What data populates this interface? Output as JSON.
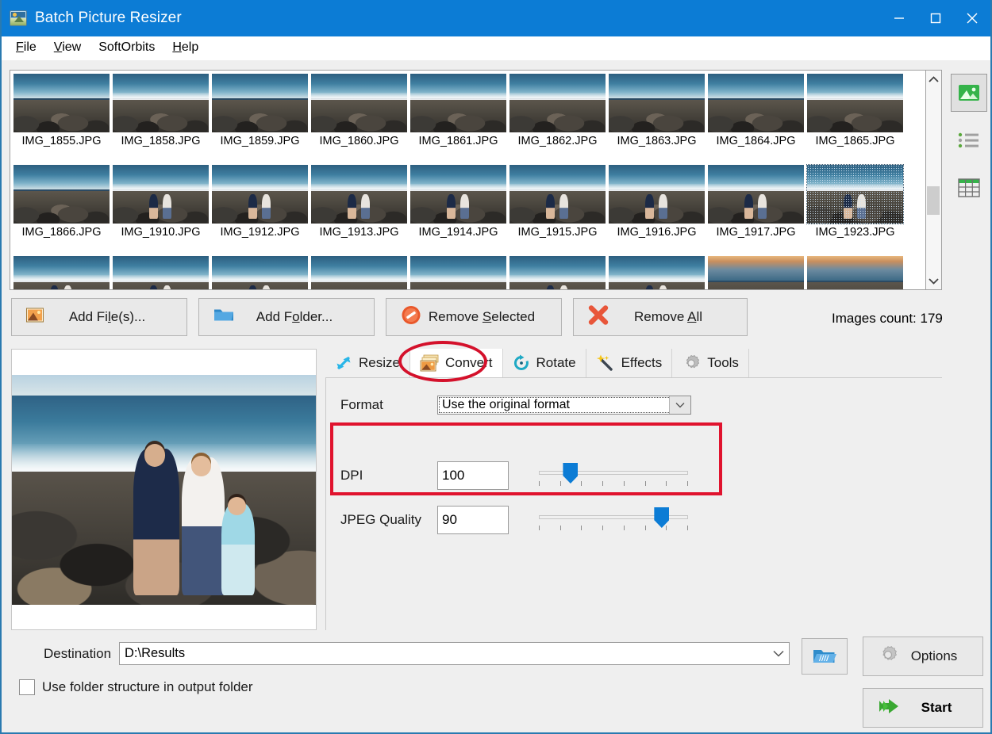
{
  "window": {
    "title": "Batch Picture Resizer",
    "accent_color": "#0c7cd5",
    "border_color": "#2a7ab0",
    "minimize_label": "Minimize",
    "maximize_label": "Maximize",
    "close_label": "Close"
  },
  "menu": {
    "items": [
      {
        "label": "File",
        "accel": "F"
      },
      {
        "label": "View",
        "accel": "V"
      },
      {
        "label": "SoftOrbits",
        "accel": ""
      },
      {
        "label": "Help",
        "accel": "H"
      }
    ]
  },
  "thumbnails": {
    "items": [
      {
        "name": "IMG_1855.JPG",
        "kind": "rocks",
        "selected": false
      },
      {
        "name": "IMG_1858.JPG",
        "kind": "foam",
        "selected": false
      },
      {
        "name": "IMG_1859.JPG",
        "kind": "rocks",
        "selected": false
      },
      {
        "name": "IMG_1860.JPG",
        "kind": "foam",
        "selected": false
      },
      {
        "name": "IMG_1861.JPG",
        "kind": "foam",
        "selected": false
      },
      {
        "name": "IMG_1862.JPG",
        "kind": "foam",
        "selected": false
      },
      {
        "name": "IMG_1863.JPG",
        "kind": "rocks",
        "selected": false
      },
      {
        "name": "IMG_1864.JPG",
        "kind": "rocks",
        "selected": false
      },
      {
        "name": "IMG_1865.JPG",
        "kind": "foam",
        "selected": false
      },
      {
        "name": "IMG_1866.JPG",
        "kind": "rocks",
        "selected": false
      },
      {
        "name": "IMG_1910.JPG",
        "kind": "people",
        "selected": false
      },
      {
        "name": "IMG_1912.JPG",
        "kind": "people",
        "selected": false
      },
      {
        "name": "IMG_1913.JPG",
        "kind": "people",
        "selected": false
      },
      {
        "name": "IMG_1914.JPG",
        "kind": "people",
        "selected": false
      },
      {
        "name": "IMG_1915.JPG",
        "kind": "people",
        "selected": false
      },
      {
        "name": "IMG_1916.JPG",
        "kind": "people",
        "selected": false
      },
      {
        "name": "IMG_1917.JPG",
        "kind": "people",
        "selected": false
      },
      {
        "name": "IMG_1923.JPG",
        "kind": "people",
        "selected": true
      },
      {
        "name": "",
        "kind": "people",
        "selected": false
      },
      {
        "name": "",
        "kind": "people",
        "selected": false
      },
      {
        "name": "",
        "kind": "people",
        "selected": false
      },
      {
        "name": "",
        "kind": "foam",
        "selected": false
      },
      {
        "name": "",
        "kind": "foam",
        "selected": false
      },
      {
        "name": "",
        "kind": "people",
        "selected": false
      },
      {
        "name": "",
        "kind": "people",
        "selected": false
      },
      {
        "name": "",
        "kind": "sunset",
        "selected": false
      },
      {
        "name": "",
        "kind": "sunset",
        "selected": false
      }
    ],
    "scrollbar": {
      "up_icon": "chevron-up-icon",
      "down_icon": "chevron-down-icon"
    }
  },
  "view_modes": [
    {
      "name": "thumbnail-view",
      "icon": "image-icon",
      "active": true
    },
    {
      "name": "list-view",
      "icon": "list-icon",
      "active": false
    },
    {
      "name": "details-view",
      "icon": "table-icon",
      "active": false
    }
  ],
  "actions": {
    "add_files": {
      "label": "Add File(s)...",
      "accel": "l",
      "icon": "picture-icon"
    },
    "add_folder": {
      "label": "Add Folder...",
      "accel": "o",
      "icon": "folder-icon"
    },
    "remove_selected": {
      "label": "Remove Selected",
      "accel": "S",
      "icon": "forbidden-icon"
    },
    "remove_all": {
      "label": "Remove All",
      "accel": "A",
      "icon": "red-x-icon"
    },
    "images_count": "Images count: 179"
  },
  "tabs": [
    {
      "label": "Resize",
      "icon": "resize-arrows-icon",
      "active": false
    },
    {
      "label": "Convert",
      "icon": "convert-images-icon",
      "active": true
    },
    {
      "label": "Rotate",
      "icon": "rotate-icon",
      "active": false
    },
    {
      "label": "Effects",
      "icon": "magic-wand-icon",
      "active": false
    },
    {
      "label": "Tools",
      "icon": "gear-icon",
      "active": false
    }
  ],
  "convert_panel": {
    "format_label": "Format",
    "format_value": "Use the original format",
    "format_options": [
      "Use the original format"
    ],
    "dpi_label": "DPI",
    "dpi_value": "100",
    "dpi_slider_percent": 18,
    "jpeg_label": "JPEG Quality",
    "jpeg_value": "90",
    "jpeg_slider_percent": 86
  },
  "annotations": {
    "highlight_color": "#e0132e",
    "ellipse_target": "Convert",
    "box_target": "DPI and JPEG Quality"
  },
  "bottom": {
    "destination_label": "Destination",
    "destination_value": "D:\\Results",
    "browse_icon": "open-folder-icon",
    "checkbox_label": "Use folder structure in output folder",
    "checkbox_checked": false,
    "options_label": "Options",
    "options_icon": "gear-icon",
    "start_label": "Start",
    "start_icon": "green-arrow-icon"
  }
}
